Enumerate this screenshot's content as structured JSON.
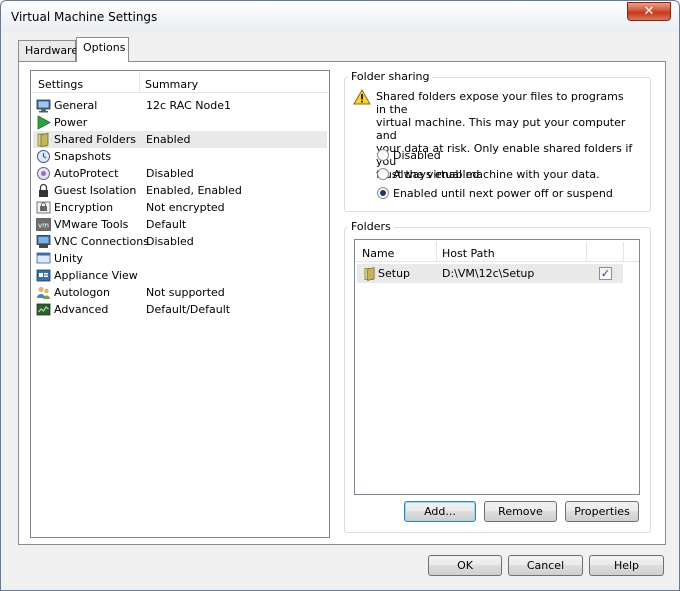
{
  "window": {
    "title": "Virtual Machine Settings",
    "close_glyph": "✕"
  },
  "tabs": [
    {
      "label": "Hardware",
      "active": false
    },
    {
      "label": "Options",
      "active": true
    }
  ],
  "settings": {
    "header": {
      "settings": "Settings",
      "summary": "Summary"
    },
    "items": [
      {
        "name": "General",
        "summary": "12c RAC Node1",
        "icon": "monitor-icon"
      },
      {
        "name": "Power",
        "summary": "",
        "icon": "play-icon"
      },
      {
        "name": "Shared Folders",
        "summary": "Enabled",
        "icon": "folder-icon",
        "selected": true
      },
      {
        "name": "Snapshots",
        "summary": "",
        "icon": "snapshot-icon"
      },
      {
        "name": "AutoProtect",
        "summary": "Disabled",
        "icon": "autoprotect-icon"
      },
      {
        "name": "Guest Isolation",
        "summary": "Enabled, Enabled",
        "icon": "lock-icon"
      },
      {
        "name": "Encryption",
        "summary": "Not encrypted",
        "icon": "encryption-icon"
      },
      {
        "name": "VMware Tools",
        "summary": "Default",
        "icon": "vmware-tools-icon"
      },
      {
        "name": "VNC Connections",
        "summary": "Disabled",
        "icon": "vnc-icon"
      },
      {
        "name": "Unity",
        "summary": "",
        "icon": "unity-icon"
      },
      {
        "name": "Appliance View",
        "summary": "",
        "icon": "appliance-icon"
      },
      {
        "name": "Autologon",
        "summary": "Not supported",
        "icon": "autologon-icon"
      },
      {
        "name": "Advanced",
        "summary": "Default/Default",
        "icon": "advanced-icon"
      }
    ]
  },
  "folder_sharing": {
    "label": "Folder sharing",
    "warning_lines": [
      "Shared folders expose your files to programs in the",
      "virtual machine. This may put your computer and",
      "your data at risk. Only enable shared folders if you",
      "trust the virtual machine with your data."
    ],
    "options": [
      {
        "label": "Disabled",
        "checked": false
      },
      {
        "label": "Always enabled",
        "checked": false
      },
      {
        "label": "Enabled until next power off or suspend",
        "checked": true
      }
    ]
  },
  "folders": {
    "label": "Folders",
    "columns": {
      "name": "Name",
      "host_path": "Host Path"
    },
    "rows": [
      {
        "name": "Setup",
        "host_path": "D:\\VM\\12c\\Setup",
        "enabled": true
      }
    ],
    "check_glyph": "✓",
    "buttons": {
      "add": "Add...",
      "remove": "Remove",
      "properties": "Properties"
    }
  },
  "footer": {
    "ok": "OK",
    "cancel": "Cancel",
    "help": "Help"
  }
}
